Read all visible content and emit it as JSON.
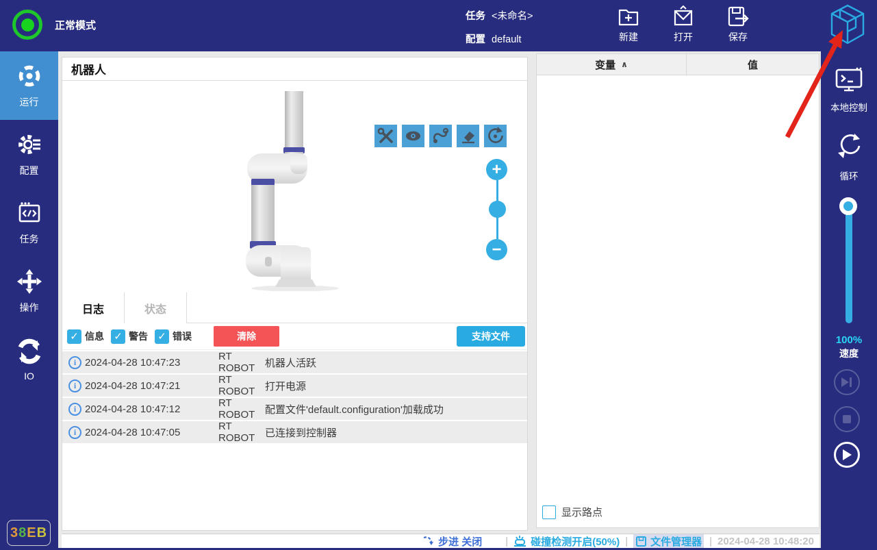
{
  "top_bar": {
    "mode_label": "正常模式",
    "task_label": "任务",
    "task_value": "<未命名>",
    "config_label": "配置",
    "config_value": "default",
    "actions": [
      {
        "label": "新建"
      },
      {
        "label": "打开"
      },
      {
        "label": "保存"
      }
    ]
  },
  "left_nav": {
    "items": [
      {
        "label": "运行",
        "active": true
      },
      {
        "label": "配置",
        "active": false
      },
      {
        "label": "任务",
        "active": false
      },
      {
        "label": "操作",
        "active": false
      },
      {
        "label": "IO",
        "active": false
      }
    ],
    "badge_chars": [
      {
        "ch": "3",
        "color": "#E09A3C"
      },
      {
        "ch": "8",
        "color": "#58B447"
      },
      {
        "ch": "E",
        "color": "#D9A43C"
      },
      {
        "ch": "B",
        "color": "#C9C23E"
      }
    ]
  },
  "robot_panel": {
    "title": "机器人",
    "tabs": [
      {
        "label": "日志",
        "active": true
      },
      {
        "label": "状态",
        "active": false
      }
    ],
    "filters": [
      {
        "label": "信息",
        "checked": true
      },
      {
        "label": "警告",
        "checked": true
      },
      {
        "label": "错误",
        "checked": true
      }
    ],
    "clear_button": "清除",
    "support_button": "支持文件",
    "logs": [
      {
        "time": "2024-04-28 10:47:23",
        "source": "RT ROBOT",
        "message": "机器人活跃"
      },
      {
        "time": "2024-04-28 10:47:21",
        "source": "RT ROBOT",
        "message": "打开电源"
      },
      {
        "time": "2024-04-28 10:47:12",
        "source": "RT ROBOT",
        "message": "配置文件'default.configuration'加载成功"
      },
      {
        "time": "2024-04-28 10:47:05",
        "source": "RT ROBOT",
        "message": "已连接到控制器"
      }
    ]
  },
  "variables_panel": {
    "col_variable": "变量",
    "col_value": "值",
    "show_waypoints_label": "显示路点",
    "show_waypoints_checked": false
  },
  "right_sidebar": {
    "local_control_label": "本地控制",
    "loop_label": "循环",
    "speed_percent": "100%",
    "speed_label": "速度"
  },
  "status_bar": {
    "step_label": "步进 关闭",
    "collision_label": "碰撞检测开启(50%)",
    "file_manager_label": "文件管理器",
    "timestamp": "2024-04-28 10:48:20"
  },
  "icons": {
    "check": "✓",
    "sort_caret": "∧",
    "info": "i",
    "zoom_in": "+",
    "zoom_out": "−"
  },
  "colors": {
    "navy": "#272C7F",
    "active_blue": "#418FD0",
    "cyan": "#29ABE2",
    "toolbar_blue": "#4BA0D6",
    "clear_red": "#F45456",
    "ok_green": "#1EC82B",
    "arrow_red": "#E2241B"
  }
}
